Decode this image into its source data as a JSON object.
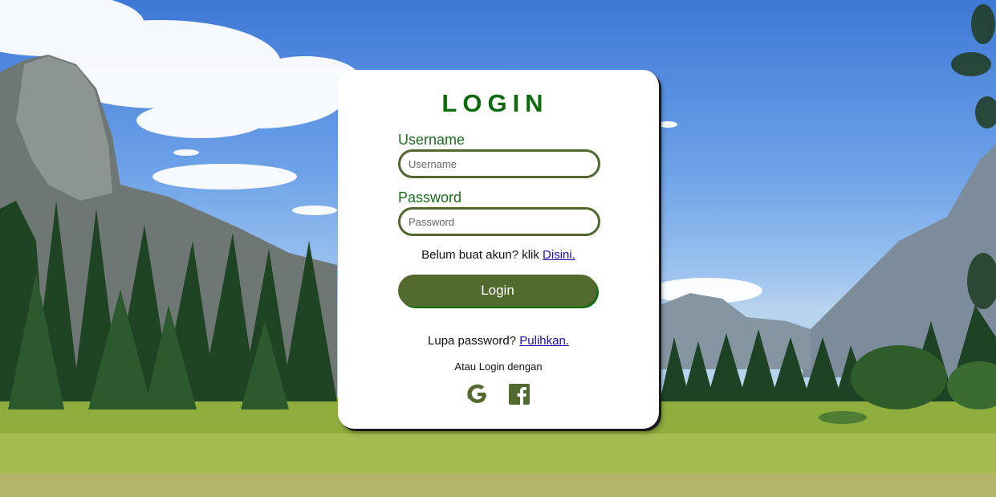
{
  "login": {
    "title": "LOGIN",
    "username_label": "Username",
    "username_placeholder": "Username",
    "username_value": "",
    "password_label": "Password",
    "password_placeholder": "Password",
    "password_value": "",
    "signup_prompt": "Belum buat akun? klik",
    "signup_link": "Disini.",
    "login_button": "Login",
    "forgot_prompt": "Lupa password?",
    "forgot_link": "Pulihkan.",
    "alt_login_text": "Atau Login dengan",
    "social_icons": [
      "google-icon",
      "facebook-icon"
    ]
  },
  "colors": {
    "title_green": "#0f6a0f",
    "accent_olive": "#536a2f",
    "link_blue": "#1a0dab",
    "card_bg": "#ffffff"
  }
}
